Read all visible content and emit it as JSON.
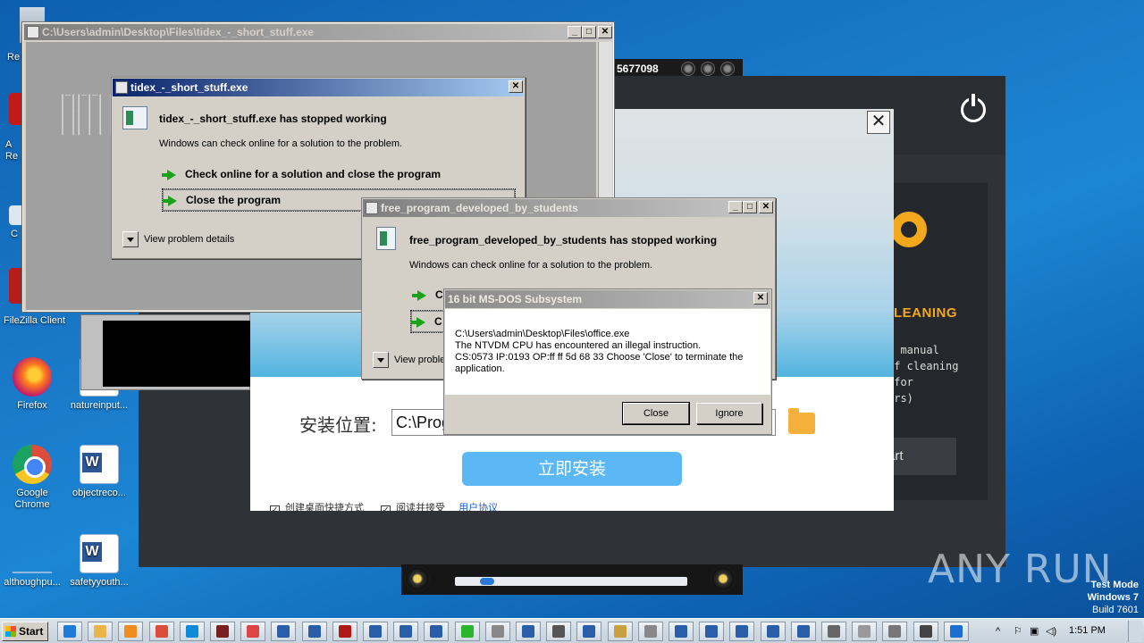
{
  "desktop_icons": [
    {
      "label": "Re",
      "kind": "blank"
    },
    {
      "label": "A\nRe",
      "kind": "blank"
    },
    {
      "label": "C",
      "kind": "blank"
    },
    {
      "label": "FileZilla Client",
      "kind": "blank"
    },
    {
      "label": "Firefox",
      "kind": "firefox"
    },
    {
      "label": "natureinput...",
      "kind": "word"
    },
    {
      "label": "Google\nChrome",
      "kind": "chrome"
    },
    {
      "label": "objectreco...",
      "kind": "word"
    },
    {
      "label": "althoughpu...",
      "kind": "blank"
    },
    {
      "label": "safetyyouth...",
      "kind": "word"
    }
  ],
  "dark_app": {
    "cleaning_title": "LEANING",
    "cleaning_text": "o manual\nof cleaning\n(for\ners)",
    "start_label": "art"
  },
  "media": {
    "counter": "5677098"
  },
  "installer": {
    "close_glyph": "✕",
    "install_location_label": "安装位置:",
    "install_path": "C:\\Prog",
    "install_button": "立即安装",
    "opt_shortcut": "创建桌面快捷方式",
    "opt_agree": "阅读并接受",
    "opt_link": "用户协议"
  },
  "console_window": {
    "title": "C:\\Users\\admin\\Desktop\\Files\\tidex_-_short_stuff.exe",
    "ascii": "  _  _ _   _ _  ___\n | || | | | | ||   \n | || | | | | || | \n | || | | | | || | \n | || | | | | || | \n | || | | | | || | \n"
  },
  "crash1": {
    "title": "tidex_-_short_stuff.exe",
    "heading": "tidex_-_short_stuff.exe has stopped working",
    "sub": "Windows can check online for a solution to the problem.",
    "option1": "Check online for a solution and close the program",
    "option2": "Close the program",
    "details": "View problem details"
  },
  "crash2": {
    "title": "free_program_developed_by_students",
    "heading": "free_program_developed_by_students has stopped working",
    "sub": "Windows can check online for a solution to the problem.",
    "option1": "C",
    "option2": "C",
    "details": "View proble"
  },
  "dos_dialog": {
    "title": "16 bit MS-DOS Subsystem",
    "line1": "C:\\Users\\admin\\Desktop\\Files\\office.exe",
    "line2": "The NTVDM CPU has encountered an illegal instruction.",
    "line3": "CS:0573 IP:0193 OP:ff ff 5d 68 33 Choose 'Close' to terminate the",
    "line4": "application.",
    "close_button": "Close",
    "ignore_button": "Ignore"
  },
  "watermark": {
    "text": "ANY RUN"
  },
  "test_mode": {
    "line1": "Test Mode",
    "line2": "Windows 7",
    "line3": "Build 7601"
  },
  "taskbar": {
    "start_label": "Start",
    "clock": "1:51 PM",
    "items": [
      {
        "name": "ie",
        "color": "#1f7ad8"
      },
      {
        "name": "explorer",
        "color": "#e7b54a"
      },
      {
        "name": "media",
        "color": "#f28c1c"
      },
      {
        "name": "chrome",
        "color": "#dd4b39"
      },
      {
        "name": "edge",
        "color": "#0d8bd6"
      },
      {
        "name": "app1",
        "color": "#7a1f1f"
      },
      {
        "name": "app2",
        "color": "#d44"
      },
      {
        "name": "win1",
        "color": "#2a5ea8"
      },
      {
        "name": "win2",
        "color": "#2a5ea8"
      },
      {
        "name": "app3",
        "color": "#b01818"
      },
      {
        "name": "win3",
        "color": "#2a5ea8"
      },
      {
        "name": "win4",
        "color": "#2a5ea8"
      },
      {
        "name": "win5",
        "color": "#2a5ea8"
      },
      {
        "name": "app4",
        "color": "#2ab52a"
      },
      {
        "name": "app5",
        "color": "#888"
      },
      {
        "name": "win6",
        "color": "#2a5ea8"
      },
      {
        "name": "app6",
        "color": "#555"
      },
      {
        "name": "win7",
        "color": "#2a5ea8"
      },
      {
        "name": "app7",
        "color": "#c8a040"
      },
      {
        "name": "app8",
        "color": "#888"
      },
      {
        "name": "win8",
        "color": "#2a5ea8"
      },
      {
        "name": "win9",
        "color": "#2a5ea8"
      },
      {
        "name": "win10",
        "color": "#2a5ea8"
      },
      {
        "name": "win11",
        "color": "#2a5ea8"
      },
      {
        "name": "win12",
        "color": "#2a5ea8"
      },
      {
        "name": "app9",
        "color": "#666"
      },
      {
        "name": "app10",
        "color": "#999"
      },
      {
        "name": "app11",
        "color": "#777"
      },
      {
        "name": "app12",
        "color": "#444"
      },
      {
        "name": "app13",
        "color": "#1c6fd1"
      }
    ]
  }
}
